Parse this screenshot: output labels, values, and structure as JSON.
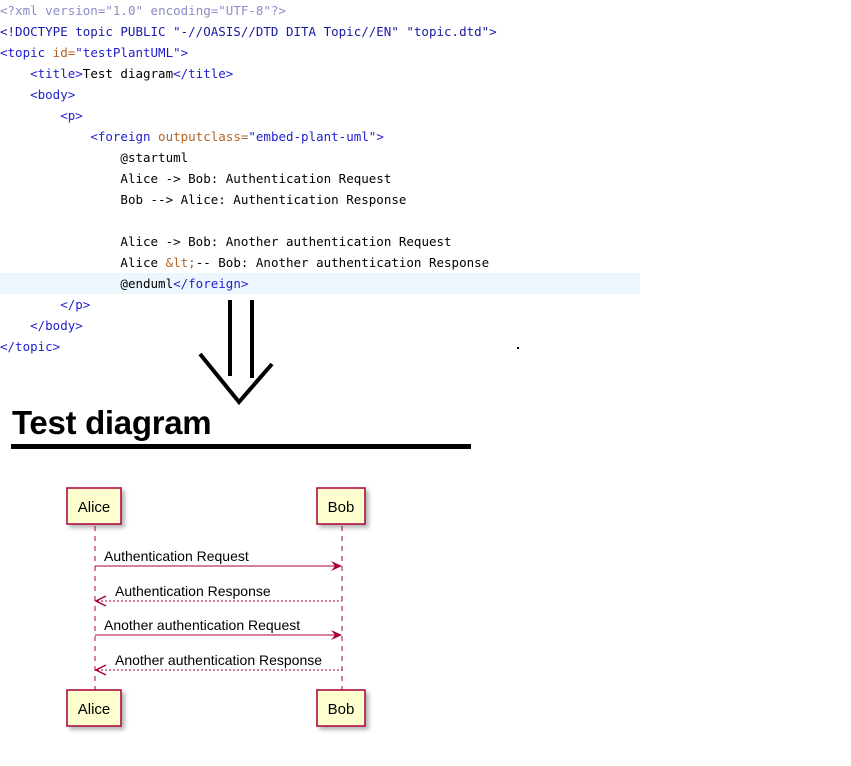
{
  "code": {
    "xml_decl_start": "<?xml ",
    "xml_decl_version_attr": "version=",
    "xml_decl_version_val": "\"1.0\"",
    "xml_decl_encoding_attr": " encoding=",
    "xml_decl_encoding_val": "\"UTF-8\"",
    "xml_decl_end": "?>",
    "doctype": "<!DOCTYPE topic PUBLIC \"-//OASIS//DTD DITA Topic//EN\" \"topic.dtd\">",
    "topic_open": "<topic",
    "topic_id_attr": " id=",
    "topic_id_val": "\"testPlantUML\"",
    "topic_open_end": ">",
    "title_open": "<title>",
    "title_text": "Test diagram",
    "title_close": "</title>",
    "body_open": "<body>",
    "p_open": "<p>",
    "foreign_open": "<foreign",
    "foreign_attr": " outputclass=",
    "foreign_val": "\"embed-plant-uml\"",
    "foreign_open_end": ">",
    "startuml": "@startuml",
    "line1": "Alice -> Bob: Authentication Request",
    "line2": "Bob --> Alice: Authentication Response",
    "line3": "Alice -> Bob: Another authentication Request",
    "line4_a": "Alice ",
    "line4_entity": "&lt;",
    "line4_b": "-- Bob: Another authentication Response",
    "enduml": "@enduml",
    "foreign_close": "</foreign>",
    "p_close": "</p>",
    "body_close": "</body>",
    "topic_close": "</topic>"
  },
  "rendered": {
    "title": "Test diagram"
  },
  "diagram": {
    "participants": {
      "left_top": "Alice",
      "right_top": "Bob",
      "left_bottom": "Alice",
      "right_bottom": "Bob"
    },
    "messages": [
      {
        "label": "Authentication Request",
        "from": "Alice",
        "to": "Bob",
        "style": "solid"
      },
      {
        "label": "Authentication Response",
        "from": "Bob",
        "to": "Alice",
        "style": "dashed"
      },
      {
        "label": "Another authentication Request",
        "from": "Alice",
        "to": "Bob",
        "style": "solid"
      },
      {
        "label": "Another authentication Response",
        "from": "Bob",
        "to": "Alice",
        "style": "dashed"
      }
    ],
    "colors": {
      "participant_fill": "#fefece",
      "participant_border": "#a80036",
      "arrow": "#a80036",
      "lifeline": "#a80036"
    }
  }
}
